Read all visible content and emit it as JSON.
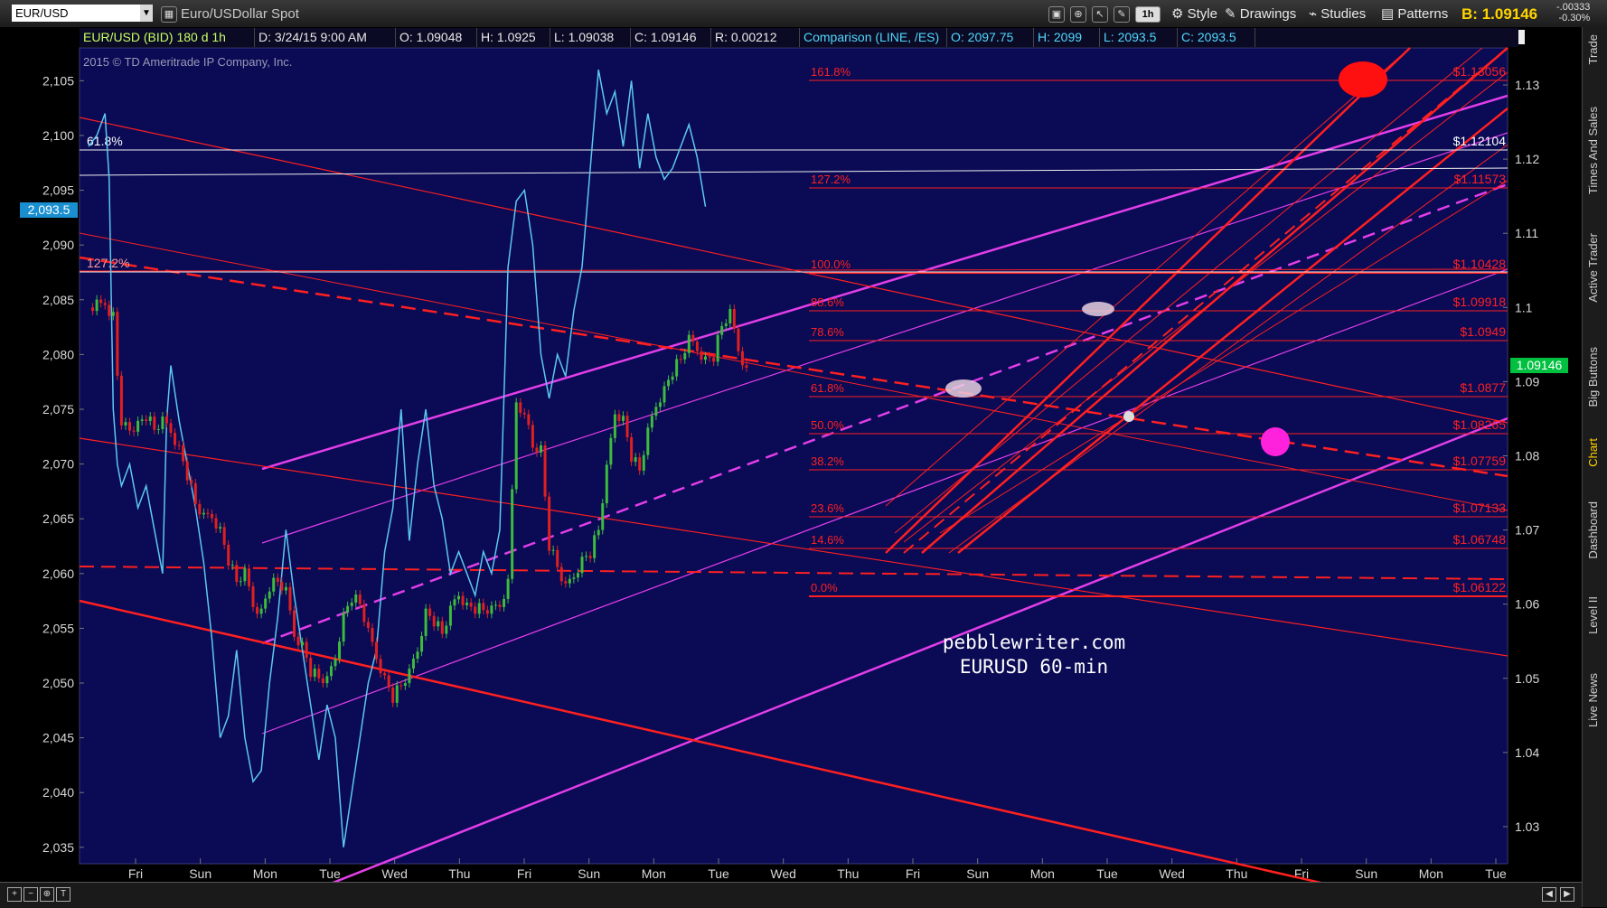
{
  "toolbar": {
    "symbol": "EUR/USD",
    "symbol_description": "Euro/USDollar Spot",
    "interval_badge": "1h",
    "style_label": "Style",
    "drawings_label": "Drawings",
    "studies_label": "Studies",
    "patterns_label": "Patterns",
    "bid_prefix": "B:",
    "bid_price": "1.09146",
    "change_abs": "-.00333",
    "change_pct": "-0.30%"
  },
  "header": {
    "instrument": "EUR/USD (BID) 180 d 1h",
    "date": "D: 3/24/15 9:00 AM",
    "open": "O: 1.09048",
    "high": "H: 1.0925",
    "low": "L: 1.09038",
    "close": "C: 1.09146",
    "range": "R: 0.00212",
    "comparison": "Comparison (LINE, /ES)",
    "cmp_open": "O: 2097.75",
    "cmp_high": "H: 2099",
    "cmp_low": "L: 2093.5",
    "cmp_close": "C: 2093.5"
  },
  "chart_data": {
    "type": "line",
    "copyright": "2015 © TD Ameritrade IP Company, Inc.",
    "watermark": [
      "pebblewriter.com",
      "EURUSD  60-min"
    ],
    "x_tick_labels": [
      "Fri",
      "Sun",
      "Mon",
      "Tue",
      "Wed",
      "Thu",
      "Fri",
      "Sun",
      "Mon",
      "Tue",
      "Wed",
      "Thu",
      "Fri",
      "Sun",
      "Mon",
      "Tue",
      "Wed",
      "Thu",
      "Fri",
      "Sun",
      "Mon",
      "Tue"
    ],
    "left_axis": {
      "ticks": [
        "2,105",
        "2,100",
        "2,095",
        "2,090",
        "2,085",
        "2,080",
        "2,075",
        "2,070",
        "2,065",
        "2,060",
        "2,055",
        "2,050",
        "2,045",
        "2,040",
        "2,035"
      ],
      "range": [
        2033.5,
        2108
      ],
      "current_value_label": "2,093.5"
    },
    "right_axis": {
      "ticks": [
        "1.13",
        "1.12",
        "1.11",
        "1.1",
        "1.09",
        "1.08",
        "1.07",
        "1.06",
        "1.05",
        "1.04",
        "1.03"
      ],
      "range": [
        1.025,
        1.135
      ],
      "current_value_label": "1.09146"
    },
    "fib_levels": [
      {
        "pct": "161.8%",
        "price": "$1.13056"
      },
      {
        "pct": "127.2%",
        "price": "$1.11573"
      },
      {
        "pct": "100.0%",
        "price": "$1.10428"
      },
      {
        "pct": "88.6%",
        "price": "$1.09918"
      },
      {
        "pct": "78.6%",
        "price": "$1.0949"
      },
      {
        "pct": "61.8%",
        "price": "$1.0877"
      },
      {
        "pct": "50.0%",
        "price": "$1.08265"
      },
      {
        "pct": "38.2%",
        "price": "$1.07759"
      },
      {
        "pct": "23.6%",
        "price": "$1.07133"
      },
      {
        "pct": "14.6%",
        "price": "$1.06748"
      },
      {
        "pct": "0.0%",
        "price": "$1.06122"
      }
    ],
    "white_levels": [
      {
        "pct": "61.8%",
        "price": "$1.12104"
      },
      {
        "pct": "127.2%",
        "price": ""
      }
    ],
    "series": [
      {
        "name": "EUR/USD",
        "kind": "candles",
        "color_up": "#3dbb3d",
        "color_down": "#e02020",
        "close_path": [
          [
            0,
            1.1
          ],
          [
            3,
            1.101
          ],
          [
            6,
            1.099
          ],
          [
            7,
            1.09
          ],
          [
            8,
            1.0845
          ],
          [
            10,
            1.0838
          ],
          [
            12,
            1.0843
          ],
          [
            14,
            1.0855
          ],
          [
            16,
            1.0835
          ],
          [
            18,
            1.0845
          ],
          [
            20,
            1.0835
          ],
          [
            22,
            1.081
          ],
          [
            24,
            1.0775
          ],
          [
            26,
            1.0735
          ],
          [
            28,
            1.0715
          ],
          [
            30,
            1.072
          ],
          [
            32,
            1.07
          ],
          [
            34,
            1.066
          ],
          [
            36,
            1.063
          ],
          [
            38,
            1.064
          ],
          [
            40,
            1.06
          ],
          [
            42,
            1.059
          ],
          [
            44,
            1.0625
          ],
          [
            46,
            1.063
          ],
          [
            48,
            1.0615
          ],
          [
            50,
            1.056
          ],
          [
            52,
            1.0545
          ],
          [
            54,
            1.051
          ],
          [
            56,
            1.05
          ],
          [
            58,
            1.0495
          ],
          [
            60,
            1.053
          ],
          [
            62,
            1.0585
          ],
          [
            64,
            1.061
          ],
          [
            66,
            1.06
          ],
          [
            68,
            1.056
          ],
          [
            70,
            1.053
          ],
          [
            72,
            1.05
          ],
          [
            74,
            1.0475
          ],
          [
            76,
            1.049
          ],
          [
            78,
            1.0505
          ],
          [
            80,
            1.054
          ],
          [
            82,
            1.059
          ],
          [
            84,
            1.0578
          ],
          [
            86,
            1.056
          ],
          [
            88,
            1.059
          ],
          [
            90,
            1.0615
          ],
          [
            92,
            1.0598
          ],
          [
            94,
            1.0595
          ],
          [
            96,
            1.0592
          ],
          [
            98,
            1.059
          ],
          [
            100,
            1.06
          ],
          [
            102,
            1.063
          ],
          [
            104,
            1.088
          ],
          [
            105,
            1.085
          ],
          [
            106,
            1.086
          ],
          [
            108,
            1.0815
          ],
          [
            110,
            1.081
          ],
          [
            112,
            1.068
          ],
          [
            114,
            1.065
          ],
          [
            116,
            1.062
          ],
          [
            118,
            1.064
          ],
          [
            120,
            1.066
          ],
          [
            122,
            1.067
          ],
          [
            124,
            1.07
          ],
          [
            126,
            1.078
          ],
          [
            128,
            1.086
          ],
          [
            130,
            1.085
          ],
          [
            132,
            1.08
          ],
          [
            134,
            1.078
          ],
          [
            136,
            1.083
          ],
          [
            138,
            1.087
          ],
          [
            140,
            1.089
          ],
          [
            142,
            1.0915
          ],
          [
            144,
            1.093
          ],
          [
            146,
            1.0955
          ],
          [
            148,
            1.0945
          ],
          [
            150,
            1.093
          ],
          [
            152,
            1.0935
          ],
          [
            154,
            1.0975
          ],
          [
            156,
            1.099
          ],
          [
            158,
            1.0945
          ],
          [
            160,
            1.0915
          ]
        ]
      },
      {
        "name": "/ES",
        "kind": "line",
        "color": "#5cc8f0",
        "points": [
          [
            0,
            2099
          ],
          [
            2,
            2100
          ],
          [
            4,
            2102
          ],
          [
            5,
            2096
          ],
          [
            6,
            2075
          ],
          [
            7,
            2070
          ],
          [
            8,
            2068
          ],
          [
            10,
            2070
          ],
          [
            12,
            2066
          ],
          [
            14,
            2068
          ],
          [
            16,
            2064
          ],
          [
            18,
            2060
          ],
          [
            19,
            2074
          ],
          [
            20,
            2079
          ],
          [
            22,
            2074
          ],
          [
            24,
            2070
          ],
          [
            26,
            2066
          ],
          [
            28,
            2061
          ],
          [
            30,
            2054
          ],
          [
            32,
            2045
          ],
          [
            34,
            2047
          ],
          [
            36,
            2053
          ],
          [
            38,
            2045
          ],
          [
            40,
            2041
          ],
          [
            42,
            2042
          ],
          [
            44,
            2050
          ],
          [
            46,
            2056
          ],
          [
            48,
            2064
          ],
          [
            50,
            2058
          ],
          [
            52,
            2053
          ],
          [
            54,
            2048
          ],
          [
            56,
            2043
          ],
          [
            58,
            2048
          ],
          [
            60,
            2045
          ],
          [
            62,
            2035
          ],
          [
            64,
            2040
          ],
          [
            66,
            2045
          ],
          [
            68,
            2050
          ],
          [
            70,
            2053
          ],
          [
            72,
            2062
          ],
          [
            74,
            2066
          ],
          [
            76,
            2075
          ],
          [
            78,
            2063
          ],
          [
            80,
            2070
          ],
          [
            82,
            2075
          ],
          [
            84,
            2068
          ],
          [
            86,
            2065
          ],
          [
            88,
            2060
          ],
          [
            90,
            2062
          ],
          [
            92,
            2060
          ],
          [
            94,
            2058
          ],
          [
            96,
            2062
          ],
          [
            98,
            2060
          ],
          [
            100,
            2064
          ],
          [
            102,
            2088
          ],
          [
            104,
            2094
          ],
          [
            106,
            2095
          ],
          [
            108,
            2090
          ],
          [
            110,
            2080
          ],
          [
            112,
            2076
          ],
          [
            114,
            2080
          ],
          [
            116,
            2078
          ],
          [
            118,
            2084
          ],
          [
            120,
            2088
          ],
          [
            122,
            2097
          ],
          [
            124,
            2106
          ],
          [
            126,
            2102
          ],
          [
            128,
            2104
          ],
          [
            130,
            2099
          ],
          [
            132,
            2105
          ],
          [
            134,
            2097
          ],
          [
            136,
            2102
          ],
          [
            138,
            2098
          ],
          [
            140,
            2096
          ],
          [
            142,
            2097
          ],
          [
            144,
            2099
          ],
          [
            146,
            2101
          ],
          [
            148,
            2098
          ],
          [
            150,
            2093.5
          ]
        ]
      }
    ]
  }
}
